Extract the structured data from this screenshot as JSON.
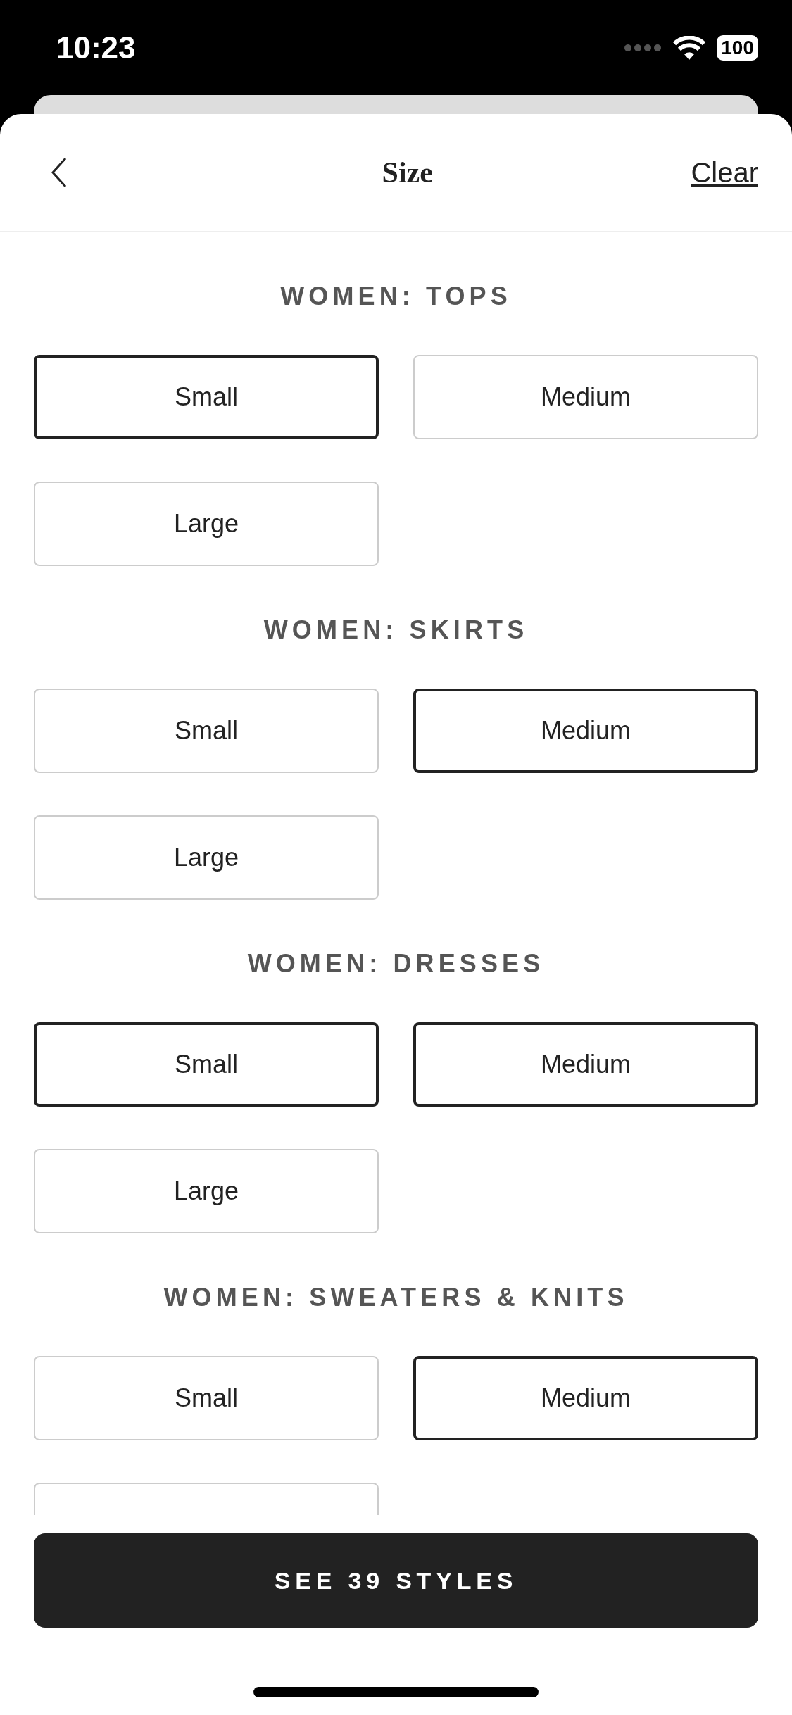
{
  "status_bar": {
    "time": "10:23",
    "battery": "100"
  },
  "header": {
    "title": "Size",
    "action": "Clear"
  },
  "sections": [
    {
      "title": "WOMEN: TOPS",
      "options": [
        {
          "label": "Small",
          "selected": true
        },
        {
          "label": "Medium",
          "selected": false
        },
        {
          "label": "Large",
          "selected": false
        }
      ]
    },
    {
      "title": "WOMEN: SKIRTS",
      "options": [
        {
          "label": "Small",
          "selected": false
        },
        {
          "label": "Medium",
          "selected": true
        },
        {
          "label": "Large",
          "selected": false
        }
      ]
    },
    {
      "title": "WOMEN: DRESSES",
      "options": [
        {
          "label": "Small",
          "selected": true
        },
        {
          "label": "Medium",
          "selected": true
        },
        {
          "label": "Large",
          "selected": false
        }
      ]
    },
    {
      "title": "WOMEN: SWEATERS & KNITS",
      "options": [
        {
          "label": "Small",
          "selected": false
        },
        {
          "label": "Medium",
          "selected": true
        },
        {
          "selected": false
        }
      ]
    }
  ],
  "footer_button": "SEE 39 STYLES"
}
